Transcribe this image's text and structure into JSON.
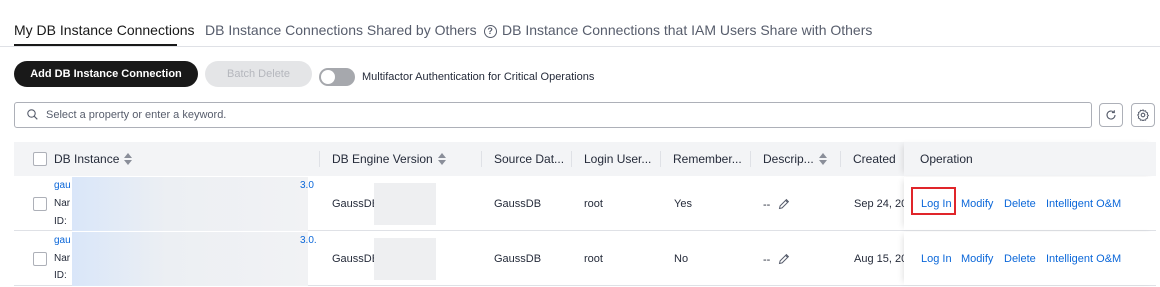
{
  "tabs": [
    {
      "label": "My DB Instance Connections",
      "active": true
    },
    {
      "label": "DB Instance Connections Shared by Others",
      "active": false
    },
    {
      "label": "DB Instance Connections that IAM Users Share with Others",
      "active": false
    }
  ],
  "toolbar": {
    "add_label": "Add DB Instance Connection",
    "batch_delete_label": "Batch Delete",
    "mfa_label": "Multifactor Authentication for Critical Operations",
    "mfa_enabled": false
  },
  "search": {
    "placeholder": "Select a property or enter a keyword."
  },
  "table": {
    "columns": [
      "DB Instance",
      "DB Engine Version",
      "Source Dat...",
      "Login User...",
      "Remember...",
      "Descrip...",
      "Created",
      "Operation"
    ],
    "rows": [
      {
        "instance_prefix": "gau",
        "instance_suffix": "3.0",
        "name_prefix": "Nar",
        "id_prefix": "ID:",
        "engine": "GaussDB",
        "source": "GaussDB",
        "login_user": "root",
        "remember": "Yes",
        "description": "--",
        "created": "Sep 24, 20",
        "actions": [
          "Log In",
          "Modify",
          "Delete",
          "Intelligent O&M"
        ]
      },
      {
        "instance_prefix": "gau",
        "instance_suffix": "3.0.",
        "name_prefix": "Nar",
        "id_prefix": "ID:",
        "engine": "GaussDB",
        "source": "GaussDB",
        "login_user": "root",
        "remember": "No",
        "description": "--",
        "created": "Aug 15, 20",
        "actions": [
          "Log In",
          "Modify",
          "Delete",
          "Intelligent O&M"
        ]
      }
    ]
  },
  "colors": {
    "link": "#0b67d9",
    "primary_button": "#191919",
    "highlight": "#e0252a"
  }
}
